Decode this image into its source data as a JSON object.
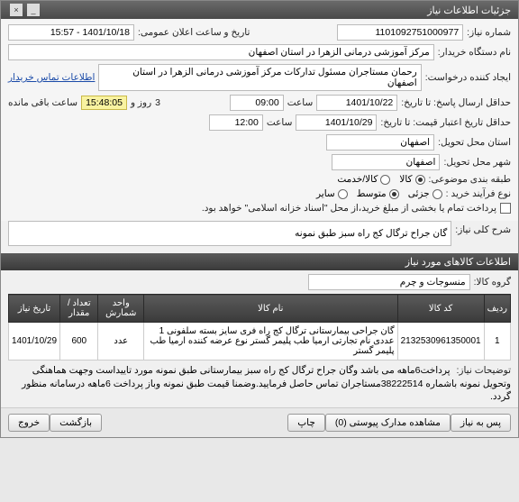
{
  "titlebar": "جزئیات اطلاعات نیاز",
  "labels": {
    "need_no": "شماره نیاز:",
    "buyer": "نام دستگاه خریدار:",
    "requester": "ایجاد کننده درخواست:",
    "announce_dt": "تاریخ و ساعت اعلان عمومی:",
    "contact_link": "اطلاعات تماس خریدار",
    "deadline": "حداقل ارسال پاسخ: تا تاریخ:",
    "hour": "ساعت",
    "day_and": "روز و",
    "remain": "ساعت باقی مانده",
    "valid_until": "حداقل تاریخ اعتبار قیمت: تا تاریخ:",
    "delivery_province": "استان محل تحویل:",
    "delivery_city": "شهر محل تحویل:",
    "category": "طبقه بندی موضوعی:",
    "purchase_type": "نوع فرآیند خرید :",
    "payment_note": "پرداخت تمام یا بخشی از مبلغ خرید،از محل \"اسناد خزانه اسلامی\" خواهد بود.",
    "need_title": "شرح کلی نیاز:",
    "goods_group": "گروه کالا:",
    "notes_lbl": "توضیحات نیاز:"
  },
  "values": {
    "need_no": "1101092751000977",
    "buyer": "مرکز آموزشی درمانی الزهرا در استان اصفهان",
    "requester": "رحمان مستاجران مسئول تدارکات مرکز آموزشی درمانی الزهرا در استان اصفهان",
    "announce_dt": "1401/10/18 - 15:57",
    "deadline_date": "1401/10/22",
    "deadline_time": "09:00",
    "days": "3",
    "countdown": "15:48:05",
    "valid_date": "1401/10/29",
    "valid_time": "12:00",
    "province": "اصفهان",
    "city": "اصفهان",
    "need_title": "گان جراح ترگال کج راه سبز طبق نمونه",
    "goods_group": "منسوجات و چرم",
    "notes": "پرداخت6ماهه می باشد وگان جراح ترگال کج راه سبز بیمارستانی طبق نمونه مورد تاییداست وجهت هماهنگی وتحویل نمونه باشماره 38222514مستاجران تماس حاصل فرمایید.وضمنا قیمت طبق نمونه وباز پرداخت 6ماهه درسامانه منظور گردد."
  },
  "category_options": {
    "goods": "کالا",
    "service": "کالا/خدمت"
  },
  "purchase_options": {
    "small": "جزئی",
    "medium": "متوسط",
    "other": "سایر"
  },
  "section_goods": "اطلاعات کالاهای مورد نیاز",
  "table": {
    "headers": {
      "row": "ردیف",
      "code": "کد کالا",
      "name": "نام کالا",
      "unit": "واحد شمارش",
      "qty": "تعداد / مقدار",
      "date": "تاریخ نیاز"
    },
    "rows": [
      {
        "row": "1",
        "code": "2132530961350001",
        "name": "گان جراحی بیمارستانی ترگال کج راه فری سایز بسته سلفونی 1 عددی نام تجارتی ارمیا طب پلیمر گستر نوع عرضه کننده ارمیا طب پلیمر گستر",
        "unit": "عدد",
        "qty": "600",
        "date": "1401/10/29"
      }
    ]
  },
  "footer": {
    "back": "پس به نیاز",
    "attachments": "مشاهده مدارک پیوستی (0)",
    "print": "چاپ",
    "close": "بازگشت",
    "exit": "خروج"
  }
}
